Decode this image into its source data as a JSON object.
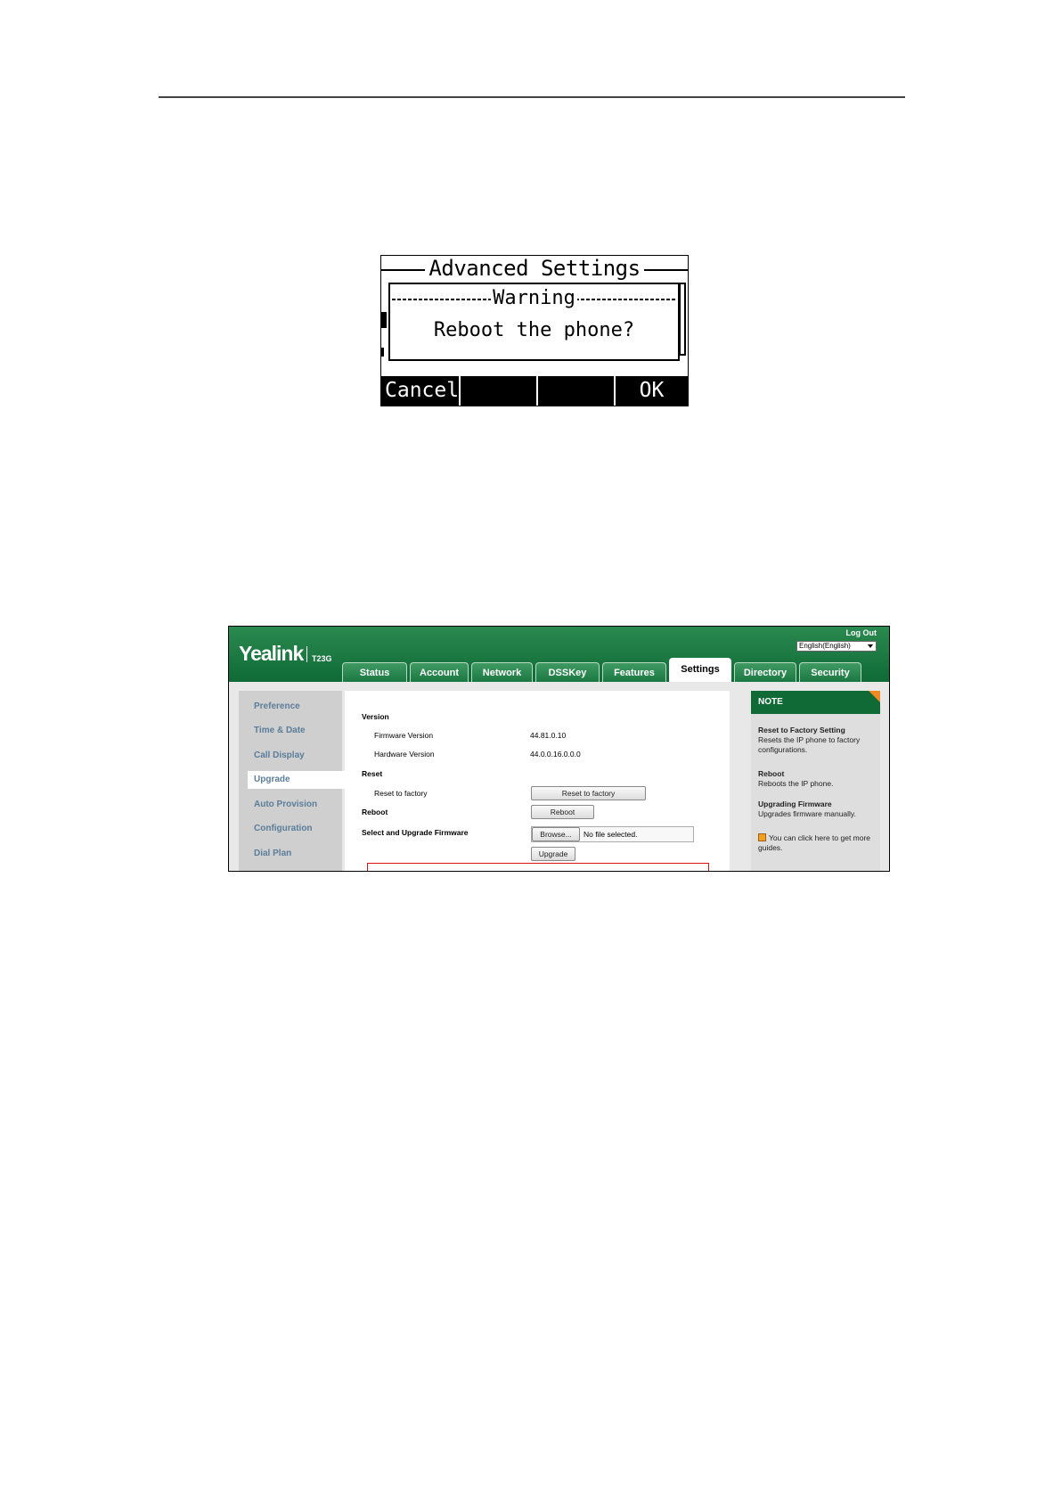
{
  "lcd": {
    "title": "Advanced Settings",
    "warning": "Warning",
    "message": "Reboot the phone?",
    "softkeys": [
      "Cancel",
      "",
      "",
      "OK"
    ]
  },
  "web": {
    "brand": "Yealink",
    "model": "T23G",
    "logout": "Log Out",
    "language": "English(English)",
    "tabs": [
      "Status",
      "Account",
      "Network",
      "DSSKey",
      "Features",
      "Settings",
      "Directory",
      "Security"
    ],
    "active_tab": "Settings",
    "sidebar": [
      "Preference",
      "Time & Date",
      "Call Display",
      "Upgrade",
      "Auto Provision",
      "Configuration",
      "Dial Plan"
    ],
    "active_sidebar": "Upgrade",
    "content": {
      "version_heading": "Version",
      "firmware_label": "Firmware Version",
      "firmware_value": "44.81.0.10",
      "hardware_label": "Hardware Version",
      "hardware_value": "44.0.0.16.0.0.0",
      "reset_heading": "Reset",
      "reset_label": "Reset to factory",
      "reset_button": "Reset to factory",
      "reboot_label": "Reboot",
      "reboot_button": "Reboot",
      "upgrade_heading": "Select and Upgrade Firmware",
      "browse_button": "Browse...",
      "file_status": "No file selected.",
      "upgrade_button": "Upgrade"
    },
    "note": {
      "heading": "NOTE",
      "reset_title": "Reset to Factory Setting",
      "reset_desc": "Resets the IP phone to factory configurations.",
      "reboot_title": "Reboot",
      "reboot_desc": "Reboots the IP phone.",
      "upgrade_title": "Upgrading Firmware",
      "upgrade_desc": "Upgrades firmware manually.",
      "guide_text": "You can click here to get more guides."
    },
    "colors": {
      "header_green": "#0f6a36",
      "highlight_red": "#dd1111",
      "note_corner": "#f08a24"
    }
  }
}
